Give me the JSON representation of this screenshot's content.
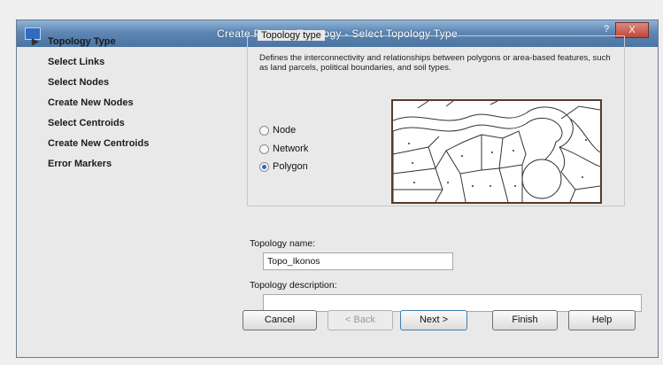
{
  "window": {
    "title": "Create Polygon Topology - Select Topology Type",
    "help_glyph": "?",
    "close_glyph": "X"
  },
  "nav": {
    "items": [
      {
        "label": "Topology Type",
        "current": true
      },
      {
        "label": "Select Links",
        "current": false
      },
      {
        "label": "Select Nodes",
        "current": false
      },
      {
        "label": "Create New Nodes",
        "current": false
      },
      {
        "label": "Select Centroids",
        "current": false
      },
      {
        "label": "Create New Centroids",
        "current": false
      },
      {
        "label": "Error Markers",
        "current": false
      }
    ]
  },
  "topology_type": {
    "legend": "Topology type",
    "description": "Defines the interconnectivity and relationships between polygons or area-based features, such as land parcels, political boundaries, and soil types.",
    "options": [
      {
        "label": "Node",
        "selected": false
      },
      {
        "label": "Network",
        "selected": false
      },
      {
        "label": "Polygon",
        "selected": true
      }
    ]
  },
  "fields": {
    "name_label": "Topology name:",
    "name_value": "Topo_Ikonos",
    "description_label": "Topology description:",
    "description_value": ""
  },
  "buttons": {
    "cancel": "Cancel",
    "back": "< Back",
    "next": "Next >",
    "finish": "Finish",
    "help": "Help"
  },
  "colors": {
    "title_bar": "#5d86b3",
    "radio_selected": "#2c6ac2",
    "image_border": "#5a3a2a"
  }
}
